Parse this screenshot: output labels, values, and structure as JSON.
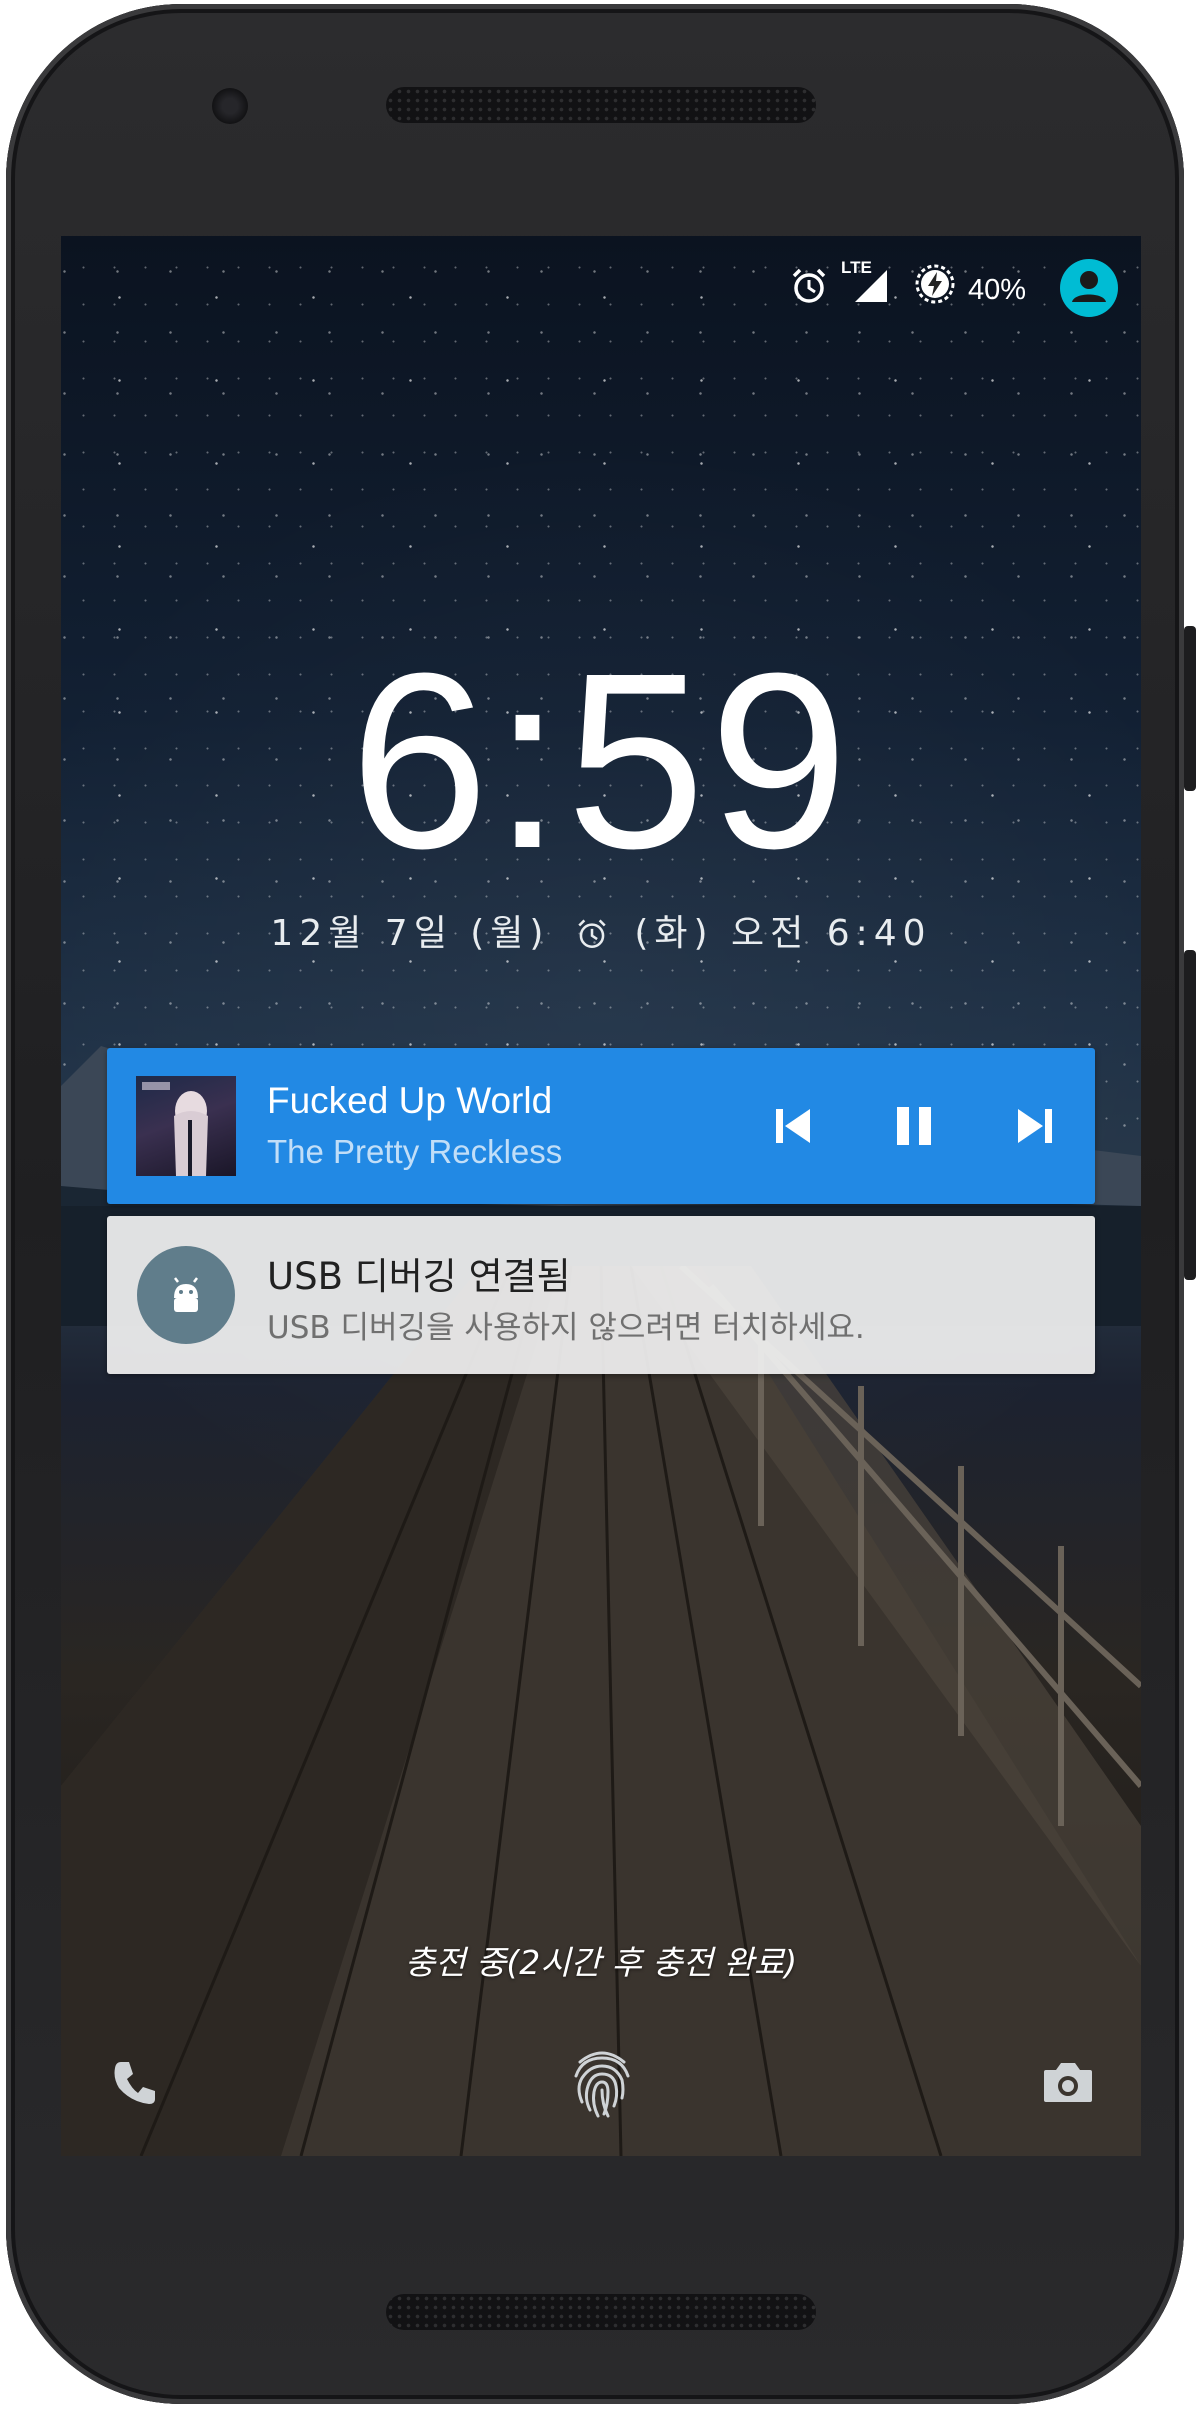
{
  "status_bar": {
    "icons": [
      "alarm-icon",
      "lte-signal-icon",
      "battery-charging-icon",
      "user-avatar-icon"
    ],
    "network_label": "LTE",
    "battery_percent": "40%",
    "accent_color": "#00bcd4"
  },
  "lockscreen": {
    "time": "6:59",
    "date": "12월 7일 (월)",
    "alarm_text": "(화) 오전 6:40"
  },
  "media_notification": {
    "title": "Fucked Up World",
    "artist": "The Pretty Reckless",
    "background_color": "#2289e4",
    "controls": [
      "skip-previous-icon",
      "pause-icon",
      "skip-next-icon"
    ]
  },
  "usb_notification": {
    "title": "USB 디버깅 연결됨",
    "text": "USB 디버깅을 사용하지 않으려면 터치하세요.",
    "icon": "android-icon",
    "icon_bg_color": "#607d8b"
  },
  "charging_text": "충전 중(2시간 후 충전 완료)",
  "bottom_shortcuts": [
    "phone-icon",
    "fingerprint-icon",
    "camera-icon"
  ]
}
